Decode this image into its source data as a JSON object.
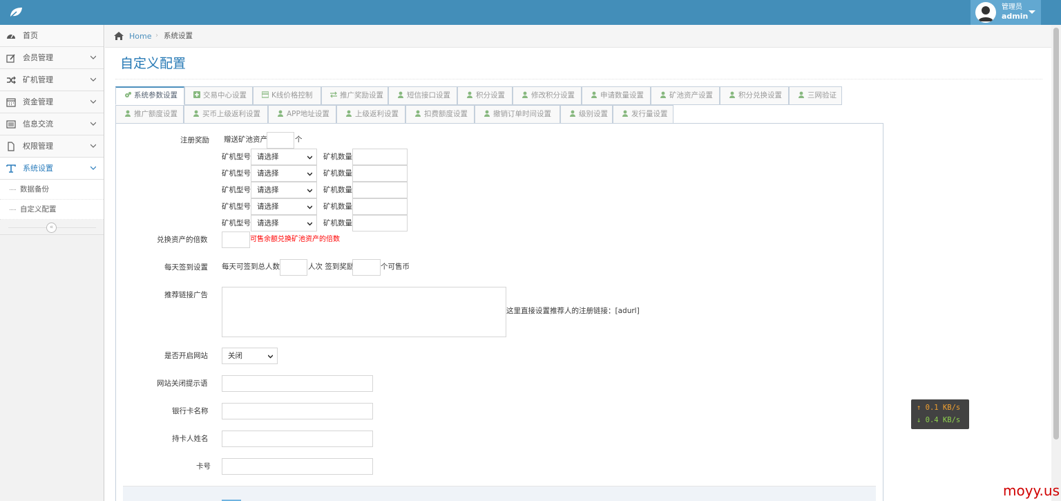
{
  "header": {
    "user_role": "管理员",
    "user_name": "admin"
  },
  "sidebar": {
    "items": [
      {
        "label": "首页"
      },
      {
        "label": "会员管理"
      },
      {
        "label": "矿机管理"
      },
      {
        "label": "资金管理"
      },
      {
        "label": "信息交流"
      },
      {
        "label": "权限管理"
      },
      {
        "label": "系统设置"
      }
    ],
    "subitems": [
      {
        "label": "数据备份"
      },
      {
        "label": "自定义配置"
      }
    ],
    "collapse_glyph": "«"
  },
  "breadcrumb": {
    "home": "Home",
    "current": "系统设置"
  },
  "page": {
    "title": "自定义配置"
  },
  "tabs": [
    "系统参数设置",
    "交易中心设置",
    "K线价格控制",
    "推广奖励设置",
    "短信接口设置",
    "积分设置",
    "修改积分设置",
    "申请数量设置",
    "矿池资产设置",
    "积分兑换设置",
    "三网验证",
    "推广额度设置",
    "买币上级返利设置",
    "APP地址设置",
    "上级返利设置",
    "扣费额度设置",
    "撤销订单时间设置",
    "级别设置",
    "发行量设置"
  ],
  "form": {
    "reg_reward": {
      "label": "注册奖励",
      "prefix": "赠送矿池资产",
      "suffix": "个",
      "value": ""
    },
    "machine_rows": [
      {
        "type_label": "矿机型号",
        "select_value": "请选择",
        "qty_label": "矿机数量",
        "qty_value": ""
      },
      {
        "type_label": "矿机型号",
        "select_value": "请选择",
        "qty_label": "矿机数量",
        "qty_value": ""
      },
      {
        "type_label": "矿机型号",
        "select_value": "请选择",
        "qty_label": "矿机数量",
        "qty_value": ""
      },
      {
        "type_label": "矿机型号",
        "select_value": "请选择",
        "qty_label": "矿机数量",
        "qty_value": ""
      },
      {
        "type_label": "矿机型号",
        "select_value": "请选择",
        "qty_label": "矿机数量",
        "qty_value": ""
      }
    ],
    "exchange": {
      "label": "兑换资产的倍数",
      "hint": "可售余额兑换矿池资产的倍数",
      "value": ""
    },
    "checkin": {
      "label": "每天签到设置",
      "prefix": "每天可签到总人数",
      "mid": "人次 签到奖励",
      "suffix": "个可售币"
    },
    "ad": {
      "label": "推荐链接广告",
      "hint": "这里直接设置推荐人的注册链接：[adurl]",
      "value": ""
    },
    "site_open": {
      "label": "是否开启网站",
      "value": "关闭"
    },
    "close_tip": {
      "label": "网站关闭提示语",
      "value": ""
    },
    "bank_name": {
      "label": "银行卡名称",
      "value": ""
    },
    "holder": {
      "label": "持卡人姓名",
      "value": ""
    },
    "card_no": {
      "label": "卡号",
      "value": ""
    }
  },
  "speed": {
    "up": "↑ 0.1 KB/s",
    "down": "↓ 0.4 KB/s"
  },
  "watermark": "moyy.us"
}
